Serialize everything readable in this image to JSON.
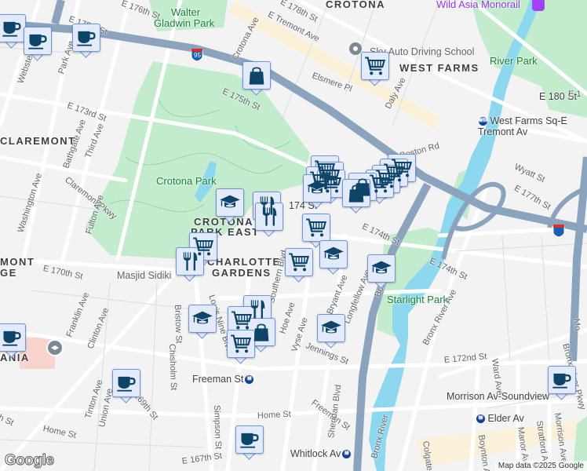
{
  "map": {
    "neighborhoods": [
      "CROTONA",
      "WEST FARMS",
      "CLAREMONT",
      "CROTONA",
      "PARK EAST",
      "CHARLOTTE",
      "GARDENS",
      "MONT",
      "GE",
      "ANIA"
    ],
    "parks": [
      "Walter",
      "Gladwin Park",
      "Crotona Park",
      "River Park",
      "Starlight Park"
    ],
    "pois": {
      "driving_school": "Sky Auto Driving School",
      "masjid": "Masjid Sidiki",
      "monorail": "Wild Asia Monorail"
    },
    "stations": {
      "west_farms_1": "West Farms Sq-E",
      "west_farms_2": "Tremont Av",
      "e180": "E 180 St",
      "freeman": "Freeman St",
      "morrison": "Morrison Av-Soundview",
      "elder": "Elder Av",
      "whitlock": "Whitlock Av",
      "e174": "174 St"
    },
    "streets": [
      "E 175th St",
      "E 176th St",
      "Webster Ave",
      "Park Ave",
      "E 173rd St",
      "Third Ave",
      "Bathgate Ave",
      "Washington Ave",
      "Claremont Pkwy",
      "Fulton Ave",
      "Crotona Ave",
      "E Tremont Ave",
      "E 178th St",
      "Elsmere Pl",
      "Daly Ave",
      "Boston Rd",
      "Wyatt St",
      "E 177th St",
      "E 174th St",
      "E 170th St",
      "Franklin Ave",
      "Clinton Ave",
      "Tinton Ave",
      "E 169th St",
      "Home St",
      "Union Ave",
      "Chisholm St",
      "Bristow St",
      "Louis Nine Blvd",
      "Southern Blvd",
      "Hoe Ave",
      "Vyse Ave",
      "Bryant Ave",
      "Longfellow Ave",
      "Boone Ave",
      "Jennings St",
      "Freeman St",
      "Simpson St",
      "Sheridan Blvd",
      "Bronx River Ave",
      "E 172nd St",
      "Ward Ave",
      "Boynton Ave",
      "Manor Ave",
      "Stratford Ave",
      "Morrison Ave",
      "Colgate Ave",
      "Bronx River",
      "E 167th St",
      "E 167th St",
      "E 174th St",
      "Bronx River Pkwy",
      "E 175th St",
      "E 1",
      "Home St",
      "Mo"
    ],
    "highway_shield": "95",
    "logo": "Google",
    "attribution": "Map data ©2025 Google",
    "metro_badge": "MTA"
  },
  "marker_types": [
    "coffee-icon",
    "shopping-bag-icon",
    "shopping-cart-icon",
    "graduation-cap-icon",
    "restaurant-icon"
  ],
  "colors": {
    "marker_icon": "#0d4468",
    "marker_bg": "#e3ebfb",
    "marker_border": "#6f95d8",
    "park": "#c3ecce",
    "water": "#8dd8ef",
    "highway": "#8ba3bd",
    "road": "#ffffff"
  }
}
